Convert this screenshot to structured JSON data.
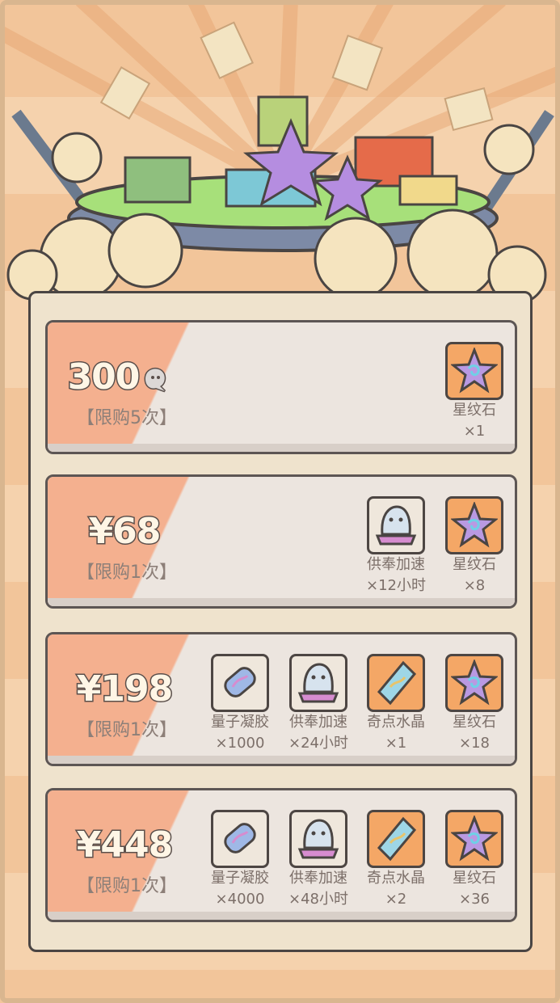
{
  "offers": [
    {
      "price": "300",
      "currency_icon": "ghost-coin-icon",
      "limit": "【限购5次】",
      "items": [
        {
          "icon": "star-stone-icon",
          "name": "星纹石",
          "qty": "×1"
        }
      ]
    },
    {
      "price": "¥68",
      "limit": "【限购1次】",
      "items": [
        {
          "icon": "ghost-speedup-icon",
          "name": "供奉加速",
          "qty": "×12小时"
        },
        {
          "icon": "star-stone-icon",
          "name": "星纹石",
          "qty": "×8"
        }
      ]
    },
    {
      "price": "¥198",
      "limit": "【限购1次】",
      "items": [
        {
          "icon": "quantum-gel-icon",
          "name": "量子凝胶",
          "qty": "×1000"
        },
        {
          "icon": "ghost-speedup-icon",
          "name": "供奉加速",
          "qty": "×24小时"
        },
        {
          "icon": "singularity-crystal-icon",
          "name": "奇点水晶",
          "qty": "×1"
        },
        {
          "icon": "star-stone-icon",
          "name": "星纹石",
          "qty": "×18"
        }
      ]
    },
    {
      "price": "¥448",
      "limit": "【限购1次】",
      "items": [
        {
          "icon": "quantum-gel-icon",
          "name": "量子凝胶",
          "qty": "×4000"
        },
        {
          "icon": "ghost-speedup-icon",
          "name": "供奉加速",
          "qty": "×48小时"
        },
        {
          "icon": "singularity-crystal-icon",
          "name": "奇点水晶",
          "qty": "×2"
        },
        {
          "icon": "star-stone-icon",
          "name": "星纹石",
          "qty": "×36"
        }
      ]
    }
  ]
}
